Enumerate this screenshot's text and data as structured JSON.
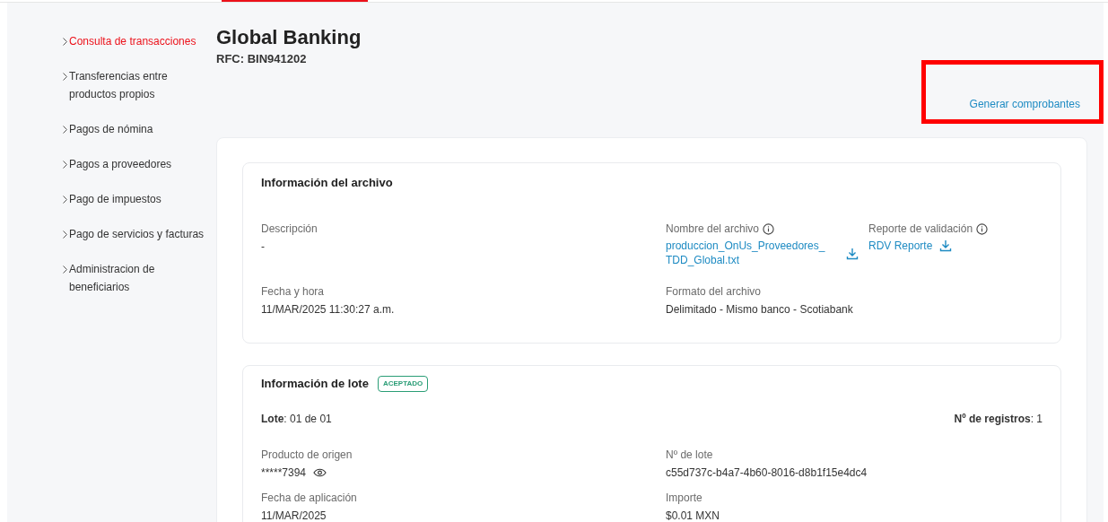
{
  "top_tabs": [
    {
      "selected": true
    }
  ],
  "sidebar": {
    "items": [
      {
        "label": "Consulta de transacciones",
        "selected": true
      },
      {
        "label": "Transferencias entre productos propios",
        "selected": false
      },
      {
        "label": "Pagos de nómina",
        "selected": false
      },
      {
        "label": "Pagos a proveedores",
        "selected": false
      },
      {
        "label": "Pago de impuestos",
        "selected": false
      },
      {
        "label": "Pago de servicios y facturas",
        "selected": false
      },
      {
        "label": "Administracion de beneficiarios",
        "selected": false
      }
    ]
  },
  "header": {
    "title": "Global Banking",
    "rfc": "RFC: BIN941202"
  },
  "generate_link": {
    "label": "Generar comprobantes",
    "highlighted": true
  },
  "file_info": {
    "title": "Información del archivo",
    "fields": [
      {
        "label": "Descripción",
        "value": "-",
        "kind": "text"
      },
      {
        "label": "Nombre del archivo",
        "value": "produccion_OnUs_Proveedores_ TDD_Global.txt",
        "kind": "download",
        "info": true
      },
      {
        "label": "Reporte de validación",
        "value": "RDV Reporte",
        "kind": "download",
        "info": true
      },
      {
        "label": "Fecha y hora",
        "value": "11/MAR/2025 11:30:27 a.m.",
        "kind": "text"
      },
      {
        "label": "Formato del archivo",
        "value": "Delimitado - Mismo banco - Scotiabank",
        "kind": "text"
      }
    ]
  },
  "batch_info": {
    "title": "Información de lote",
    "status": "ACEPTADO",
    "lote": {
      "label": "Lote",
      "value": ": 01 de 01"
    },
    "records": {
      "label": "Nº de registros",
      "value": ": 1"
    },
    "fields": [
      {
        "label": "Producto de origen",
        "value": "*****7394",
        "kind": "masked"
      },
      {
        "label": "Nº de lote",
        "value": "c55d737c-b4a7-4b60-8016-d8b1f15e4dc4",
        "kind": "text"
      },
      {
        "label": "Fecha de aplicación",
        "value": "11/MAR/2025",
        "kind": "text"
      },
      {
        "label": "Importe",
        "value": "$0.01 MXN",
        "kind": "text"
      }
    ]
  }
}
